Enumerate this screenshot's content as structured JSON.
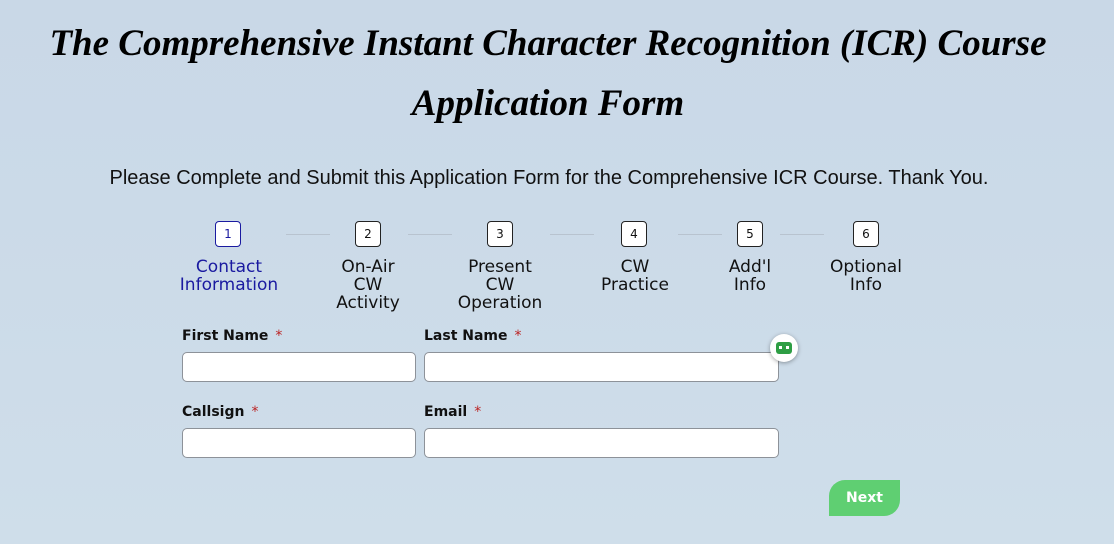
{
  "header": {
    "title_line1": "The Comprehensive Instant Character Recognition (ICR) Course",
    "title_line2": "Application Form",
    "subtitle": "Please Complete and Submit this Application Form for the Comprehensive ICR Course.  Thank You."
  },
  "steps": [
    {
      "number": "1",
      "label": "Contact Information"
    },
    {
      "number": "2",
      "label": "On-Air CW Activity"
    },
    {
      "number": "3",
      "label": "Present CW Operation"
    },
    {
      "number": "4",
      "label": "CW Practice"
    },
    {
      "number": "5",
      "label": "Add'l Info"
    },
    {
      "number": "6",
      "label": "Optional Info"
    }
  ],
  "form": {
    "first_name": {
      "label": "First Name",
      "required": "*",
      "value": ""
    },
    "last_name": {
      "label": "Last Name",
      "required": "*",
      "value": ""
    },
    "callsign": {
      "label": "Callsign",
      "required": "*",
      "value": ""
    },
    "email": {
      "label": "Email",
      "required": "*",
      "value": ""
    }
  },
  "next_label": "Next",
  "colors": {
    "active_step": "#1a1aa0",
    "next_button": "#5fcf72",
    "required_marker": "#b22222"
  },
  "icons": {
    "autofill": "password-manager-icon"
  }
}
